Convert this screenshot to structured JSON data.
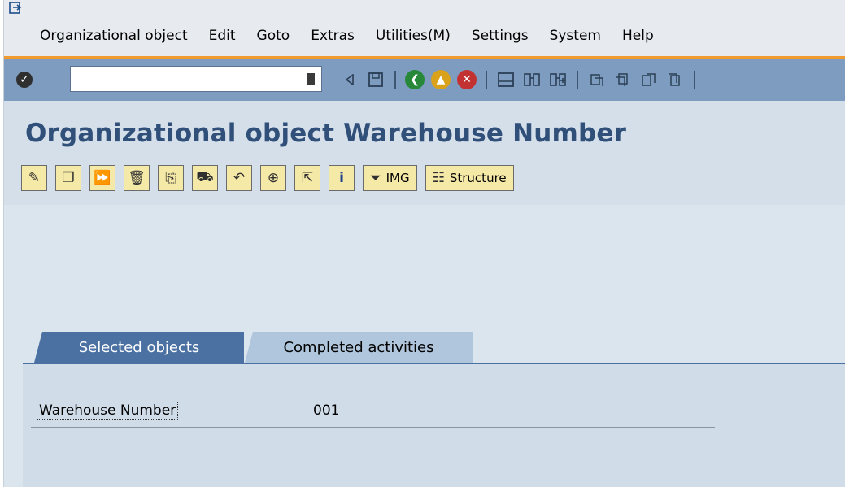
{
  "menubar": {
    "items": [
      "Organizational object",
      "Edit",
      "Goto",
      "Extras",
      "Utilities(M)",
      "Settings",
      "System",
      "Help"
    ]
  },
  "toolbar": {
    "command_value": "",
    "icons": [
      "enter-icon",
      "dropdown-icon",
      "back-arrow-icon",
      "save-icon",
      "back-icon",
      "exit-icon",
      "cancel-icon",
      "print-icon",
      "find-icon",
      "find-next-icon",
      "first-page-icon",
      "previous-page-icon",
      "next-page-icon",
      "last-page-icon"
    ]
  },
  "page": {
    "title": "Organizational object Warehouse Number"
  },
  "app_toolbar": {
    "img_label": "IMG",
    "structure_label": "Structure"
  },
  "tabs": [
    {
      "label": "Selected objects",
      "active": true
    },
    {
      "label": "Completed activities",
      "active": false
    }
  ],
  "fields": {
    "warehouse_label": "Warehouse Number",
    "warehouse_value": "001"
  },
  "colors": {
    "accent_orange": "#ef9b2f",
    "toolbar_blue": "#7d9cbf",
    "title_blue": "#30507a",
    "tab_active": "#4a71a1",
    "tab_inactive": "#b0c6dc"
  }
}
